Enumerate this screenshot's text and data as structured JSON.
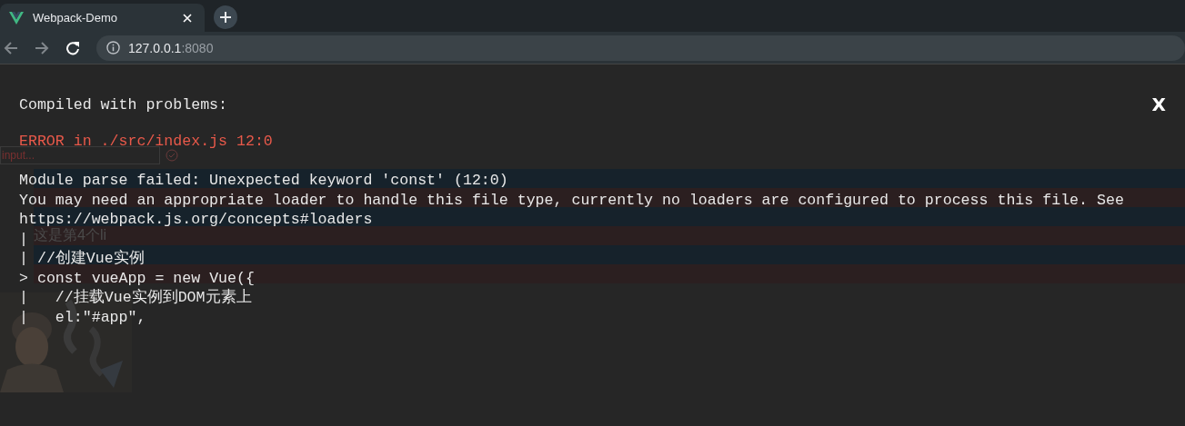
{
  "browser": {
    "tab": {
      "title": "Webpack-Demo",
      "selected": true
    },
    "address": {
      "host": "127.0.0.1",
      "port": ":8080"
    }
  },
  "page": {
    "input": {
      "placeholder": "input..."
    },
    "list_rows": [
      {
        "color": "#16222b"
      },
      {
        "color": "#2b1f20"
      },
      {
        "color": "#16222b"
      },
      {
        "color": "#2b1f20",
        "label": "这是第4个li"
      },
      {
        "color": "#16222b"
      },
      {
        "color": "#2b1f20"
      }
    ]
  },
  "overlay": {
    "title": "Compiled with problems:",
    "close": "X",
    "error_header": "ERROR in ./src/index.js 12:0",
    "message_lines": [
      "Module parse failed: Unexpected keyword 'const' (12:0)",
      "You may need an appropriate loader to handle this file type, currently no loaders are configured to process this file. See",
      "https://webpack.js.org/concepts#loaders"
    ],
    "code_lines": [
      {
        "marker": "|"
      },
      {
        "marker": "|",
        "text": " //创建Vue实例"
      },
      {
        "marker": ">",
        "text": " const vueApp = new Vue({"
      },
      {
        "marker": "|",
        "text": "   //挂载Vue实例到DOM元素上"
      },
      {
        "marker": "|",
        "text": "   el:\"#app\","
      }
    ]
  }
}
